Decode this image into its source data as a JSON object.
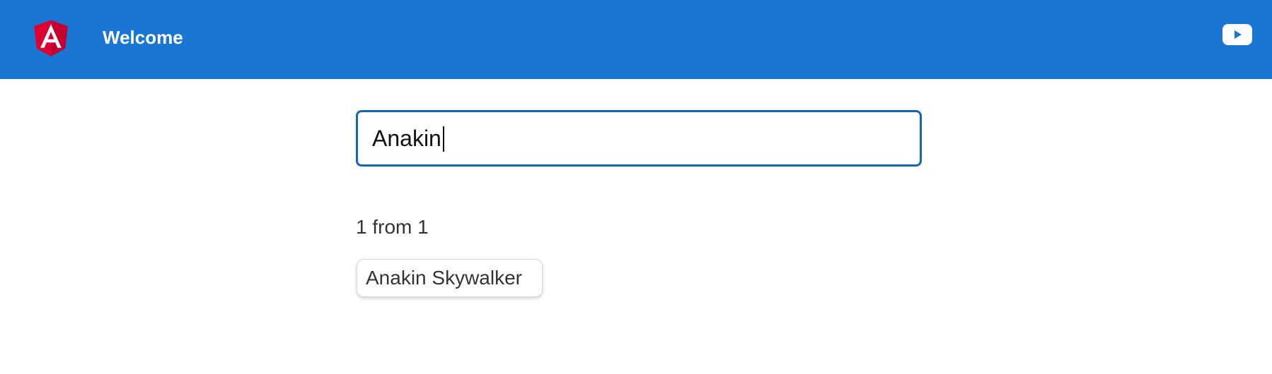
{
  "toolbar": {
    "title": "Welcome",
    "logo_icon": "angular-logo-icon",
    "action_icon": "youtube-icon",
    "color": "#1976d2"
  },
  "search": {
    "value": "Anakin",
    "placeholder": ""
  },
  "results": {
    "count_text": "1 from 1",
    "items": [
      {
        "label": "Anakin Skywalker"
      }
    ]
  },
  "colors": {
    "accent": "#1565c0",
    "logo_red": "#dd0031"
  }
}
